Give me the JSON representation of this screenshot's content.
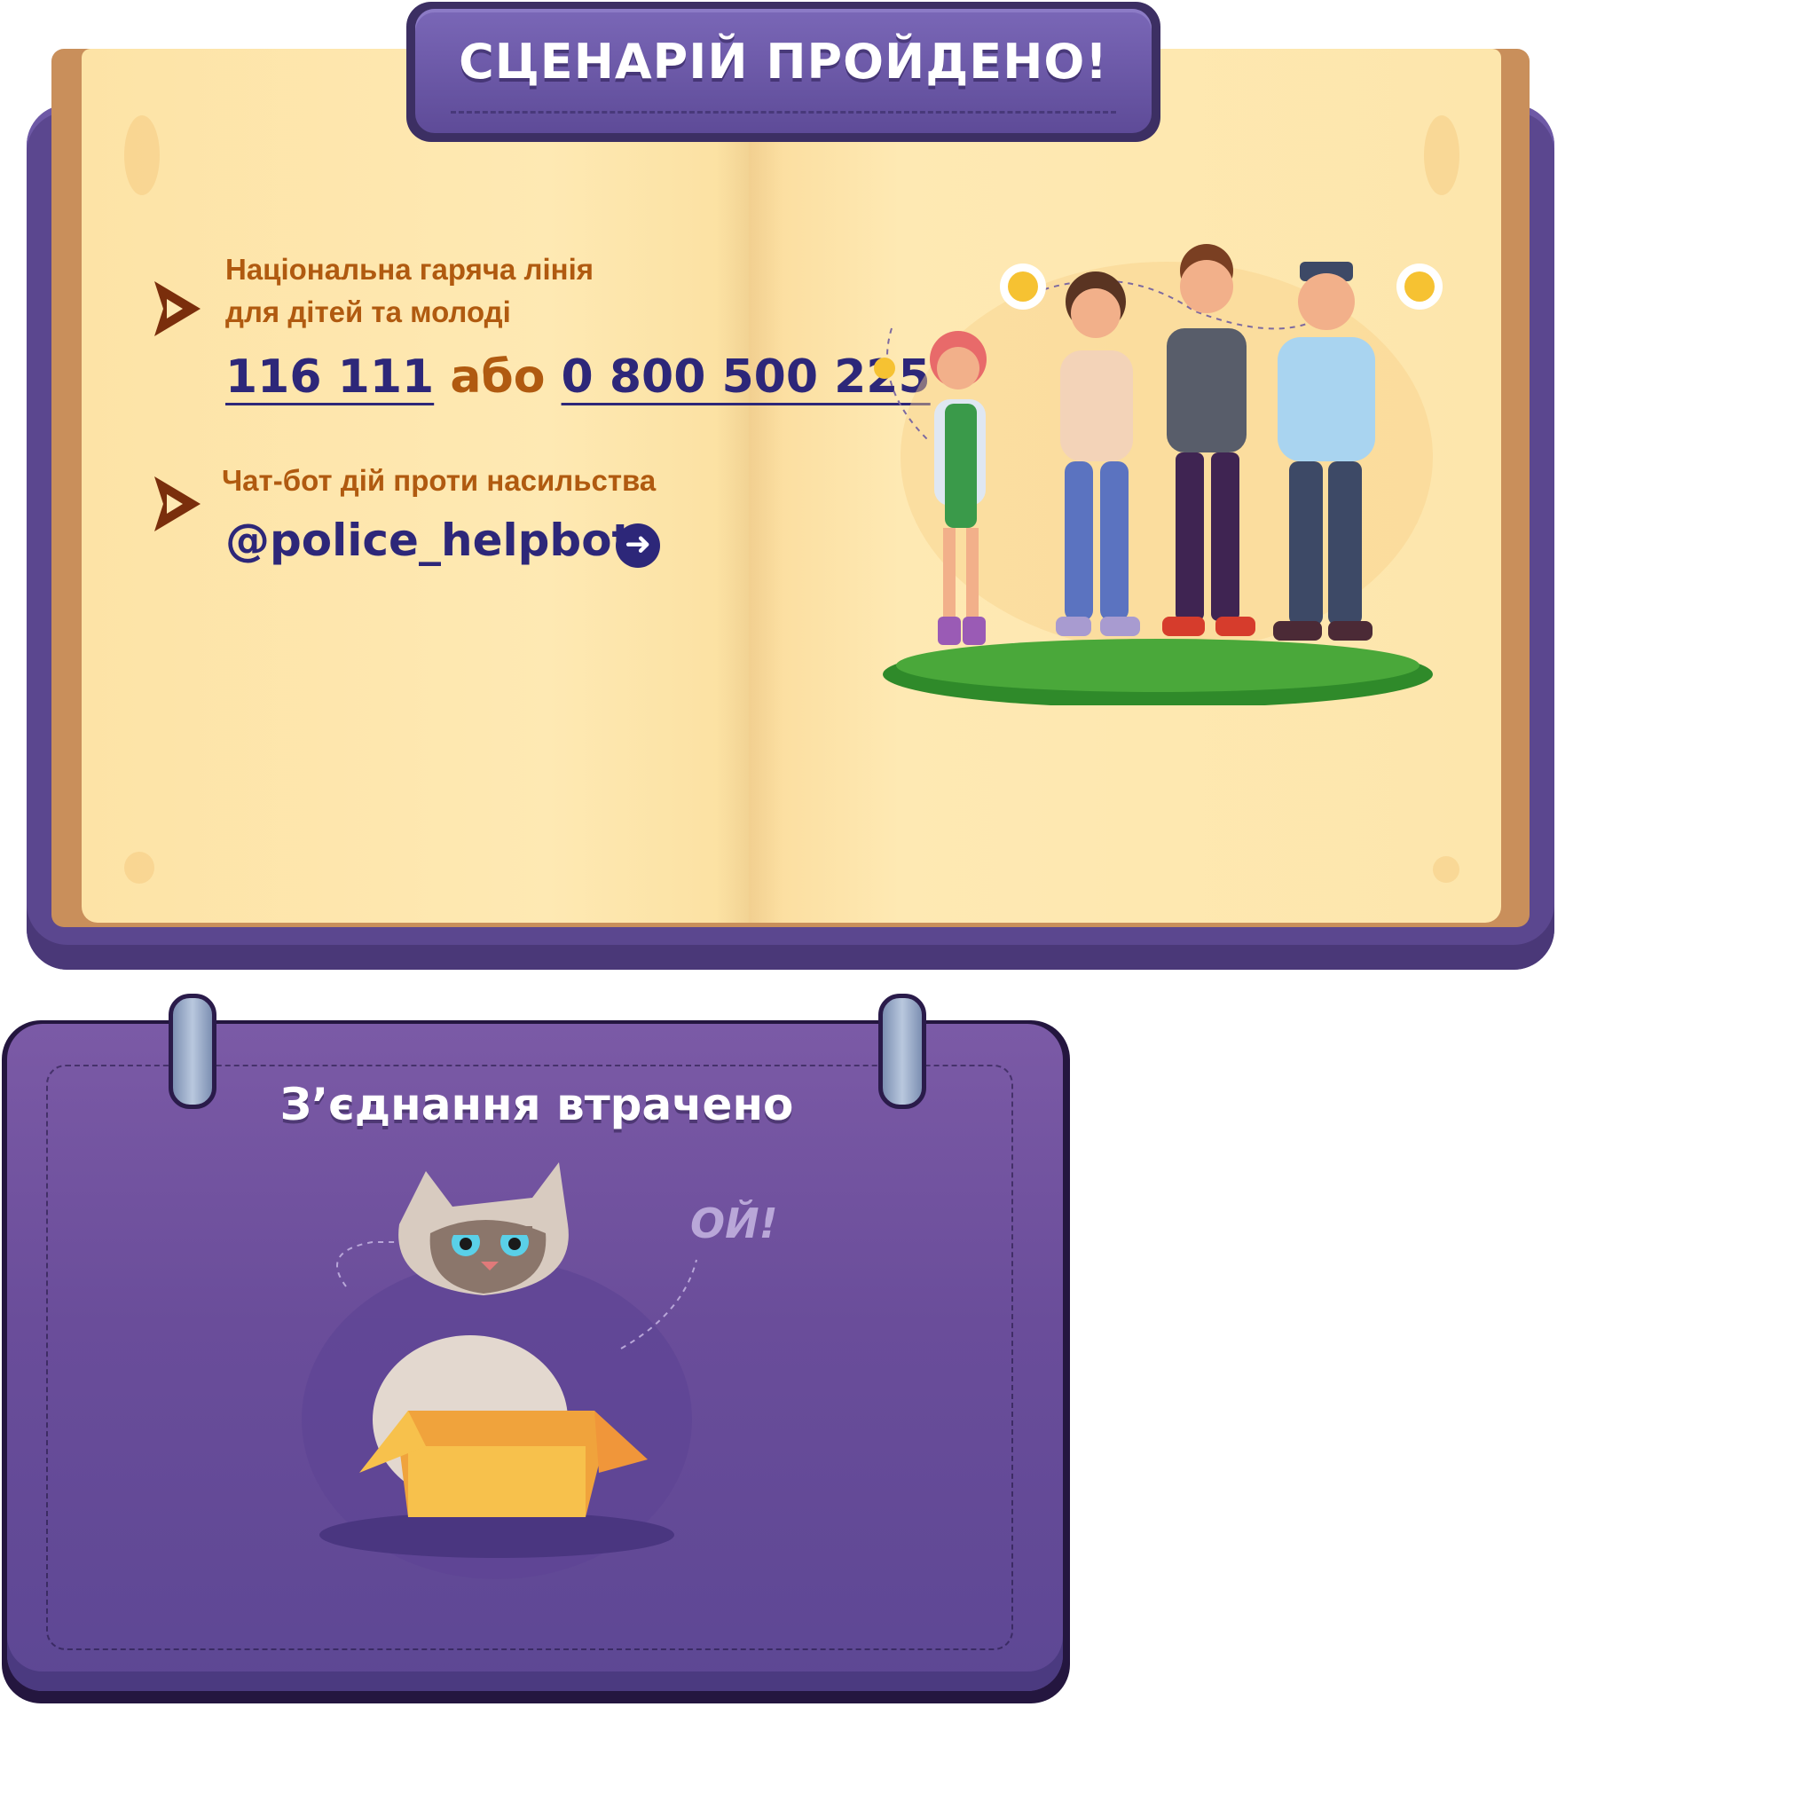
{
  "banner": {
    "title": "СЦЕНАРІЙ ПРОЙДЕНО!"
  },
  "hotline": {
    "label_line1": "Національна гаряча лінія",
    "label_line2": "для дітей та молоді",
    "phone1": "116 111",
    "or_word": "або",
    "phone2": "0 800 500 225"
  },
  "chatbot": {
    "label": "Чат-бот дій проти насильства",
    "handle": "@police_helpbot"
  },
  "dialog": {
    "title": "З’єднання втрачено",
    "exclamation": "ОЙ!"
  },
  "icons": {
    "bullet": "play-arrow-icon",
    "go": "arrow-right-circle-icon",
    "illustration": "family-illustration",
    "cat": "grumpy-cat-in-box-illustration"
  },
  "colors": {
    "accent_purple": "#5b478f",
    "text_navy": "#2d2779",
    "text_orange": "#b05a10",
    "page": "#fee9b3"
  }
}
